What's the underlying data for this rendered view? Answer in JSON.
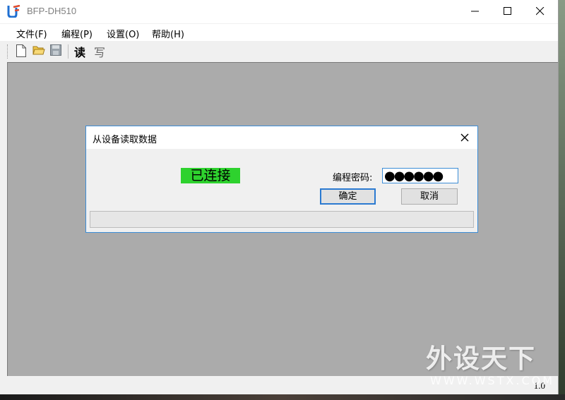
{
  "window": {
    "title": "BFP-DH510"
  },
  "menu": {
    "items": [
      {
        "label": "文件(F)"
      },
      {
        "label": "编程(P)"
      },
      {
        "label": "设置(O)"
      },
      {
        "label": "帮助(H)"
      }
    ]
  },
  "toolbar": {
    "icons": [
      "new-file-icon",
      "open-folder-icon",
      "save-disk-icon"
    ],
    "read_label": "读",
    "write_label": "写"
  },
  "dialog": {
    "title": "从设备读取数据",
    "status": "已连接",
    "password_label": "编程密码:",
    "password_value": "●●●●●●",
    "ok_label": "确定",
    "cancel_label": "取消",
    "progress": 0
  },
  "statusbar": {
    "version": "1.0"
  },
  "watermark": {
    "main": "外设天下",
    "sub": "WWW.WSTX.COM"
  },
  "colors": {
    "status_green": "#2ed22e",
    "accent_blue": "#3c8dd6",
    "workspace_gray": "#ababab"
  }
}
